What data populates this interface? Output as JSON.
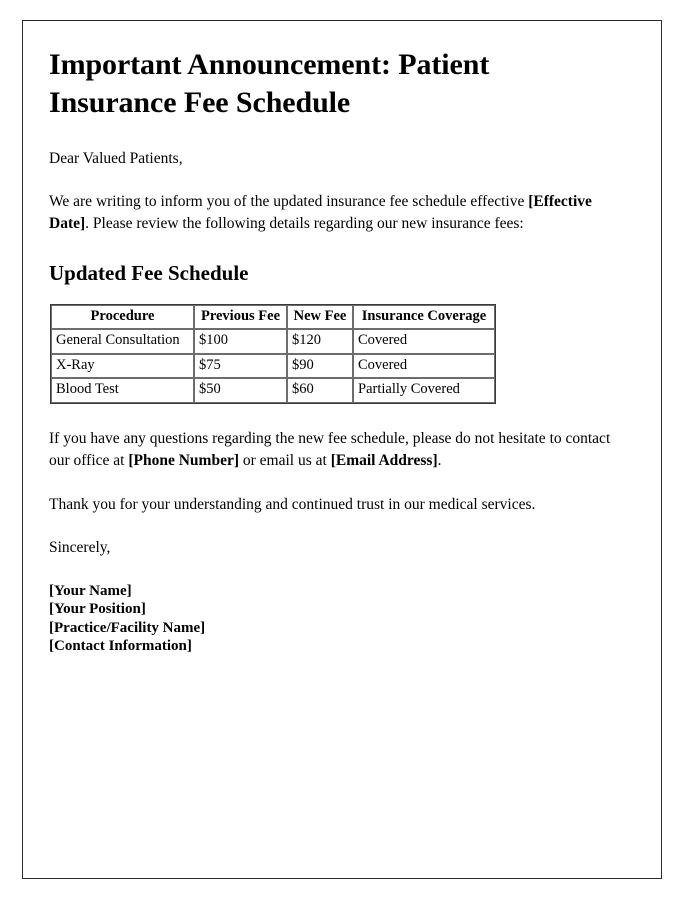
{
  "document": {
    "title": "Important Announcement: Patient Insurance Fee Schedule",
    "salutation": "Dear Valued Patients,",
    "intro": {
      "part1": "We are writing to inform you of the updated insurance fee schedule effective ",
      "placeholder1": "[Effective Date]",
      "part2": ". Please review the following details regarding our new insurance fees:"
    },
    "section_heading": "Updated Fee Schedule",
    "fee_table": {
      "headers": [
        "Procedure",
        "Previous Fee",
        "New Fee",
        "Insurance Coverage"
      ],
      "rows": [
        {
          "procedure": "General Consultation",
          "previous_fee": "$100",
          "new_fee": "$120",
          "coverage": "Covered"
        },
        {
          "procedure": "X-Ray",
          "previous_fee": "$75",
          "new_fee": "$90",
          "coverage": "Covered"
        },
        {
          "procedure": "Blood Test",
          "previous_fee": "$50",
          "new_fee": "$60",
          "coverage": "Partially Covered"
        }
      ]
    },
    "contact": {
      "part1": "If you have any questions regarding the new fee schedule, please do not hesitate to contact our office at ",
      "placeholder_phone": "[Phone Number]",
      "part2": " or email us at ",
      "placeholder_email": "[Email Address]",
      "part3": "."
    },
    "thanks": "Thank you for your understanding and continued trust in our medical services.",
    "signoff": "Sincerely,",
    "signature": [
      "[Your Name]",
      "[Your Position]",
      "[Practice/Facility Name]",
      "[Contact Information]"
    ]
  }
}
